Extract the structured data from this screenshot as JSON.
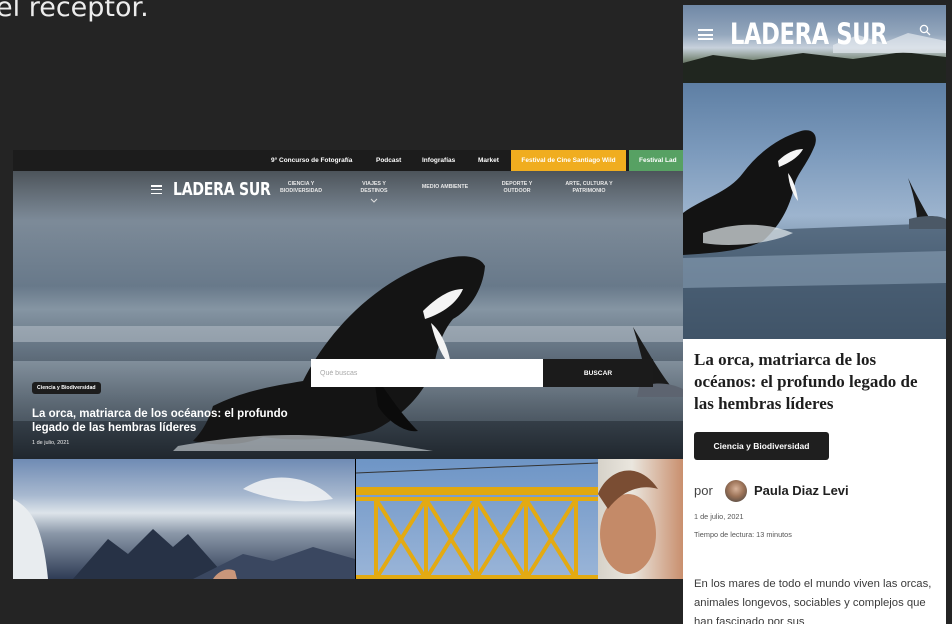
{
  "caption_fragment": "el receptor.",
  "desktop": {
    "topbar": {
      "concurso": "9° Concurso de Fotografía",
      "podcast": "Podcast",
      "infografias": "Infografías",
      "market": "Market",
      "festival_sw": "Festival de Cine Santiago Wild",
      "festival_ladera": "Festival Lad"
    },
    "logo": "LADERA SUR",
    "nav": {
      "item1": "CIENCIA Y\nBIODIVERSIDAD",
      "item2": "VIAJES Y\nDESTINOS",
      "item3": "MEDIO AMBIENTE",
      "item4": "DEPORTE Y\nOUTDOOR",
      "item5": "ARTE, CULTURA Y\nPATRIMONIO"
    },
    "search": {
      "placeholder": "Qué buscas",
      "button": "BUSCAR"
    },
    "hero": {
      "category": "Ciencia y Biodiversidad",
      "title": "La orca, matriarca de los océanos: el profundo legado de las hembras líderes",
      "date": "1 de julio, 2021"
    },
    "colors": {
      "topbar_bg": "#1c1c1c",
      "festival_sw": "#f0ad1f",
      "festival_ladera": "#57a163"
    }
  },
  "mobile": {
    "logo": "LADERA SUR",
    "title": "La orca, matriarca de los océanos: el profundo legado de las hembras líderes",
    "category": "Ciencia y Biodiversidad",
    "by": "por",
    "author": "Paula Diaz Levi",
    "date": "1 de julio, 2021",
    "read_time": "Tiempo de lectura: 13 minutos",
    "excerpt": "En los mares de todo el mundo viven las orcas, animales longevos, sociables y complejos que han fascinado por sus"
  },
  "icons": [
    "menu-icon",
    "search-icon",
    "chevron-down-icon",
    "avatar"
  ]
}
